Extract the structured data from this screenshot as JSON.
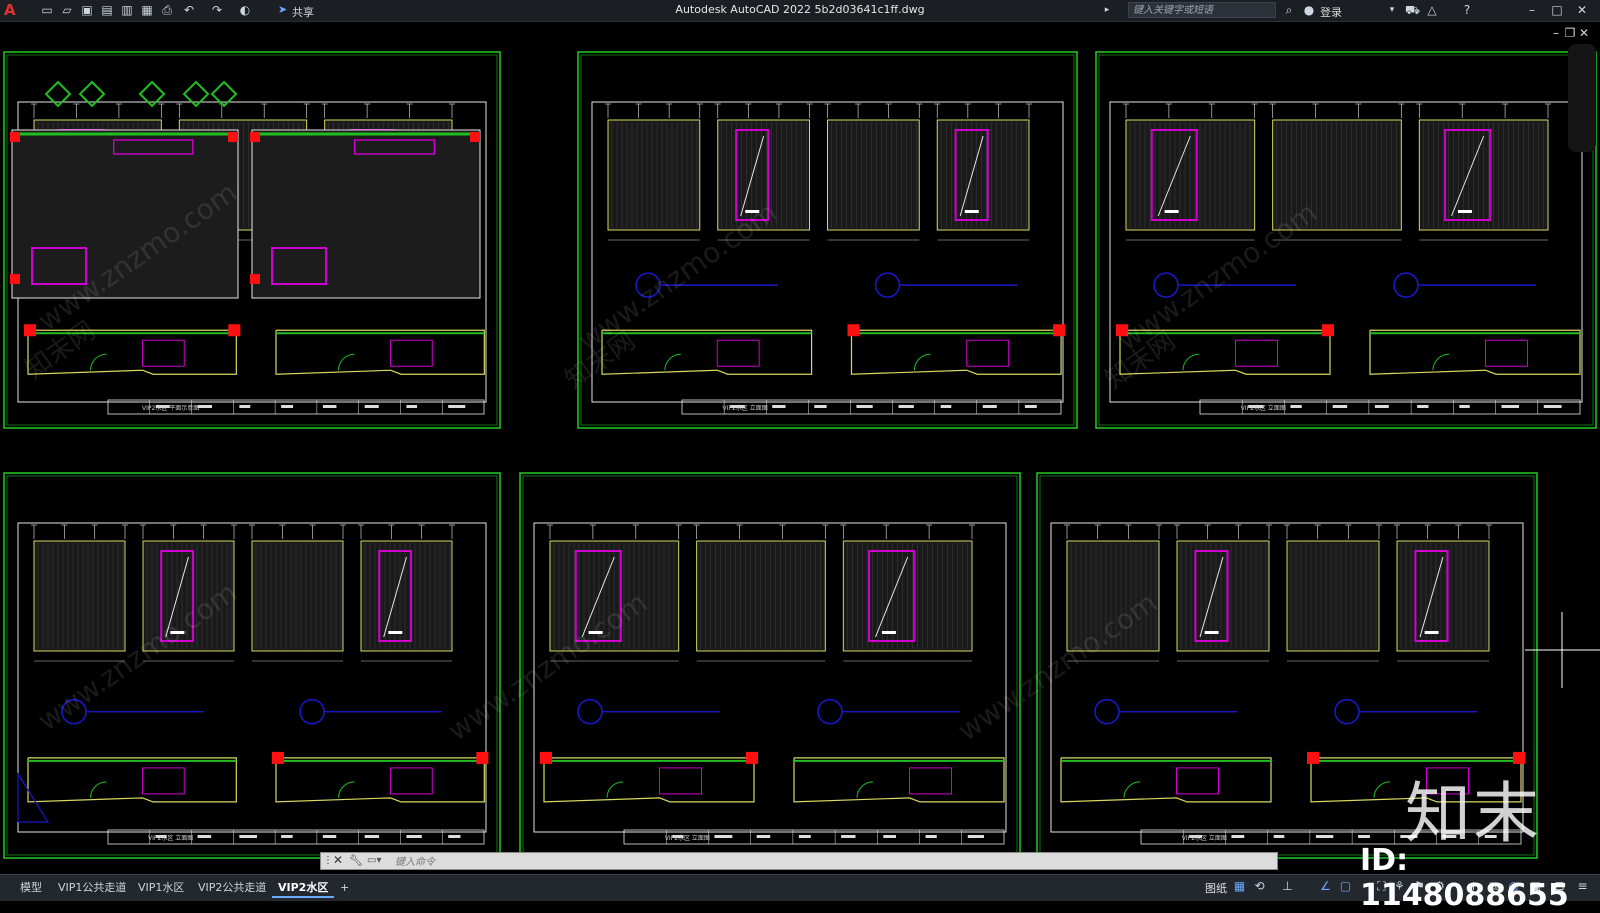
{
  "titlebar": {
    "app_logo": "A",
    "share_label": "共享",
    "title": "Autodesk AutoCAD 2022    5b2d03641c1ff.dwg",
    "search_placeholder": "键入关键字或短语",
    "login_label": "登录"
  },
  "sheets": [
    {
      "title": "VIP2水区 平面示意图"
    },
    {
      "title": "VIP2水区 立面图"
    },
    {
      "title": "VIP2水区 立面图"
    },
    {
      "title": "VIP2水区 立面图"
    },
    {
      "title": "VIP2水区 立面图"
    },
    {
      "title": "VIP2水区 立面图"
    }
  ],
  "command_line": {
    "placeholder": "键入命令"
  },
  "layout_tabs": [
    {
      "label": "模型",
      "active": false
    },
    {
      "label": "VIP1公共走道",
      "active": false
    },
    {
      "label": "VIP1水区",
      "active": false
    },
    {
      "label": "VIP2公共走道",
      "active": false
    },
    {
      "label": "VIP2水区",
      "active": true
    }
  ],
  "status": {
    "paper_label": "图纸"
  },
  "watermark": {
    "logo": "知末",
    "id": "ID: 1148088655",
    "site": "www.znzmo.com",
    "brand": "知末网"
  },
  "colors": {
    "frame": "#1fbf1f",
    "magenta": "#d000d0",
    "yellow": "#d8d860",
    "blue": "#1818c8",
    "red": "#ff1010",
    "background": "#000000"
  }
}
